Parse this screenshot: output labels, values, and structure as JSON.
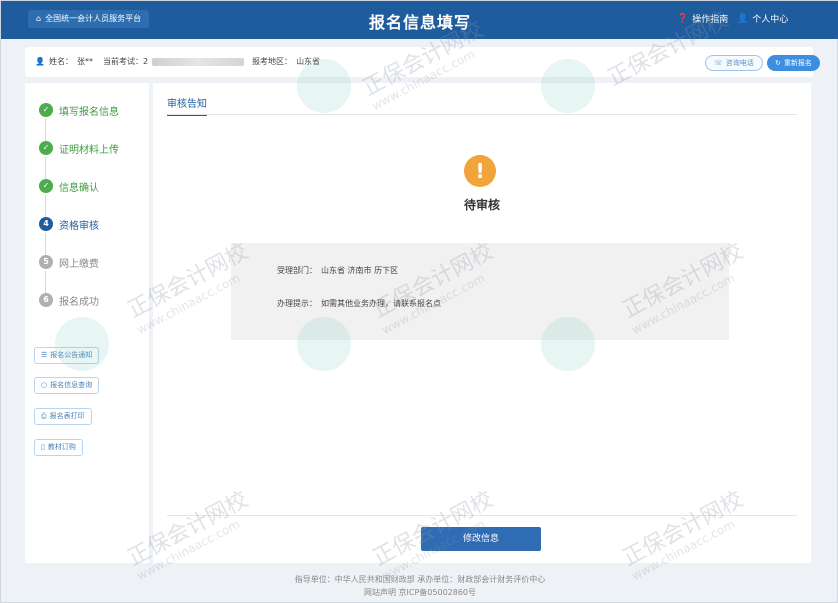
{
  "header": {
    "platform_label": "全国统一会计人员服务平台",
    "title": "报名信息填写",
    "guide_label": "操作指南",
    "user_center_label": "个人中心"
  },
  "info_bar": {
    "name_label": "姓名：",
    "name_value": "张**",
    "exam_label": "当前考试：2",
    "area_label": "报考地区：",
    "area_value": "山东省",
    "btn_query": "咨询电话",
    "btn_reregister": "重新报名"
  },
  "steps": [
    {
      "num": "✓",
      "label": "填写报名信息",
      "state": "done"
    },
    {
      "num": "✓",
      "label": "证明材料上传",
      "state": "done"
    },
    {
      "num": "✓",
      "label": "信息确认",
      "state": "done"
    },
    {
      "num": "4",
      "label": "资格审核",
      "state": "current"
    },
    {
      "num": "5",
      "label": "网上缴费",
      "state": "pending"
    },
    {
      "num": "6",
      "label": "报名成功",
      "state": "pending"
    }
  ],
  "side_buttons": [
    {
      "icon": "☰",
      "label": "报名公告通知"
    },
    {
      "icon": "○",
      "label": "报名信息查询"
    },
    {
      "icon": "⎙",
      "label": "报名表打印"
    },
    {
      "icon": "▯",
      "label": "教材订购"
    }
  ],
  "main": {
    "tab_label": "审核告知",
    "status_icon": "!",
    "status_title": "待审核",
    "dept_label": "受理部门：",
    "dept_value": "山东省 济南市 历下区",
    "tip_label": "办理提示：",
    "tip_value": "如需其他业务办理，请联系报名点",
    "modify_button": "修改信息"
  },
  "footer": {
    "line1": "指导单位：中华人民共和国财政部    承办单位：财政部会计财务评价中心",
    "line2": "网站声明    京ICP备05002860号"
  },
  "watermark": {
    "cn": "正保会计网校",
    "en": "www.chinaacc.com"
  },
  "colors": {
    "header_bg": "#1f5c9e",
    "done": "#4bad4b",
    "current": "#1f5c9e",
    "warning": "#f0a43a",
    "primary_button": "#2f6cb3"
  }
}
